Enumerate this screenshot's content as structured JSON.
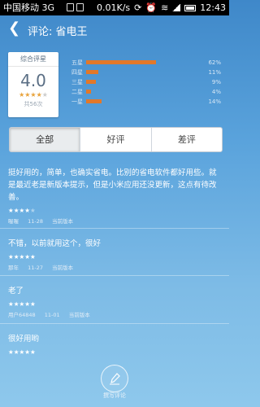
{
  "status_bar": {
    "carrier": "中国移动 3G",
    "speed": "0.01K/s",
    "time": "12:43"
  },
  "header": {
    "title": "评论: 省电王"
  },
  "summary": {
    "label": "综合评星",
    "score": "4.0",
    "rating_stars": 4,
    "count": "共56次",
    "distribution": [
      {
        "label": "五星",
        "percent": "62%",
        "value": 62
      },
      {
        "label": "四星",
        "percent": "11%",
        "value": 11
      },
      {
        "label": "三星",
        "percent": "9%",
        "value": 9
      },
      {
        "label": "二星",
        "percent": "4%",
        "value": 4
      },
      {
        "label": "一星",
        "percent": "14%",
        "value": 14
      }
    ],
    "bar_color": "#e2782a"
  },
  "tabs": [
    {
      "label": "全部",
      "active": true
    },
    {
      "label": "好评",
      "active": false
    },
    {
      "label": "差评",
      "active": false
    }
  ],
  "reviews": [
    {
      "text": "挺好用的，简单，也确实省电。比别的省电软件都好用些。就是最近老是新版本提示，但是小米应用还没更新，这点有待改善。",
      "stars": 4,
      "user": "喔喔",
      "date": "11-28",
      "version": "当前版本"
    },
    {
      "text": "不错，以前就用这个，很好",
      "stars": 5,
      "user": "那年",
      "date": "11-27",
      "version": "当前版本"
    },
    {
      "text": "老了",
      "stars": 5,
      "user": "用户64848",
      "date": "11-01",
      "version": "当前版本"
    },
    {
      "text": "很好用哟",
      "stars": 5
    }
  ],
  "write_review": {
    "label": "撰写评论"
  }
}
